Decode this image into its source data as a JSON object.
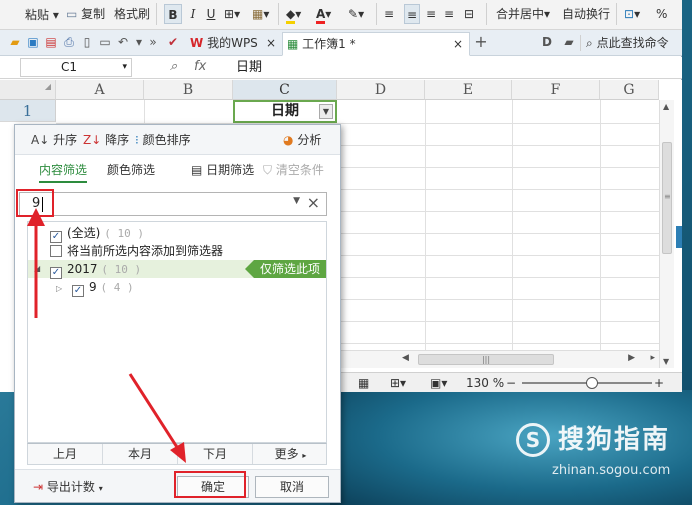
{
  "ribbon": {
    "paste": "粘贴",
    "copy": "复制",
    "format_painter": "格式刷",
    "bold": "B",
    "italic": "I",
    "underline": "U",
    "merge_center": "合并居中",
    "wrap_text": "自动换行",
    "percent": "%"
  },
  "tabs": {
    "my_wps": "我的WPS",
    "workbook": "工作簿1 *",
    "find_command": "点此查找命令"
  },
  "formula_bar": {
    "cell_ref": "C1",
    "fx": "fx",
    "value": "日期"
  },
  "sheet": {
    "columns": [
      "A",
      "B",
      "C",
      "D",
      "E",
      "F",
      "G"
    ],
    "rows": [
      "1"
    ],
    "c1_value": "日期"
  },
  "status": {
    "zoom": "130 %"
  },
  "filter_popup": {
    "sort_asc": "升序",
    "sort_desc": "降序",
    "color_sort": "颜色排序",
    "analyze": "分析",
    "tab_content": "内容筛选",
    "tab_color": "颜色筛选",
    "date_filter": "日期筛选",
    "clear_condition": "清空条件",
    "search_value": "9",
    "list": {
      "select_all": "(全选)",
      "select_all_count": "( 10 )",
      "add_to_filter": "将当前所选内容添加到筛选器",
      "year": "2017",
      "year_count": "( 10 )",
      "only_this": "仅筛选此项",
      "month": "9",
      "month_count": "( 4 )"
    },
    "date_buttons": [
      "上月",
      "本月",
      "下月",
      "更多"
    ],
    "export_count": "导出计数",
    "ok": "确定",
    "cancel": "取消"
  },
  "watermark": {
    "brand": "搜狗指南",
    "url": "zhinan.sogou.com"
  },
  "colors": {
    "accent_green": "#5ea642",
    "annotation_red": "#e0222a",
    "tab_green": "#2d8c3e"
  }
}
